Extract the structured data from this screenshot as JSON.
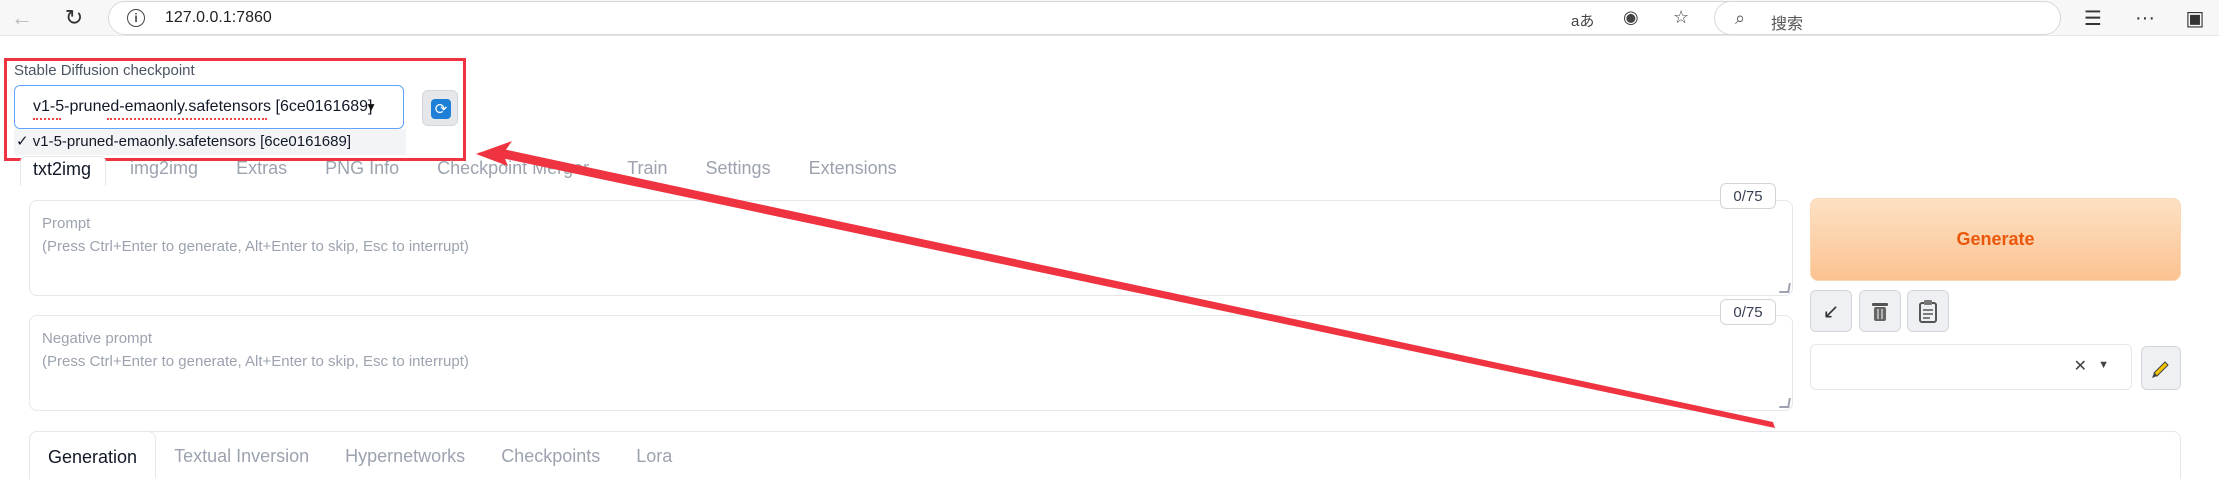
{
  "browser": {
    "url": "127.0.0.1:7860",
    "search_placeholder": "搜索",
    "read_aloud_glyph": "aあ"
  },
  "checkpoint": {
    "label": "Stable Diffusion checkpoint",
    "selected": "v1-5-pruned-emaonly.safetensors [6ce0161689]",
    "option": "✓ v1-5-pruned-emaonly.safetensors [6ce0161689]"
  },
  "tabs": [
    "txt2img",
    "img2img",
    "Extras",
    "PNG Info",
    "Checkpoint Merger",
    "Train",
    "Settings",
    "Extensions"
  ],
  "prompt": {
    "label": "Prompt",
    "hint": "(Press Ctrl+Enter to generate, Alt+Enter to skip, Esc to interrupt)",
    "counter": "0/75"
  },
  "negative_prompt": {
    "label": "Negative prompt",
    "hint": "(Press Ctrl+Enter to generate, Alt+Enter to skip, Esc to interrupt)",
    "counter": "0/75"
  },
  "generate_label": "Generate",
  "subtabs": [
    "Generation",
    "Textual Inversion",
    "Hypernetworks",
    "Checkpoints",
    "Lora"
  ],
  "colors": {
    "annotation_red": "#ef3340",
    "generate_text": "#ea580c",
    "refresh_blue": "#1d7fd8"
  }
}
